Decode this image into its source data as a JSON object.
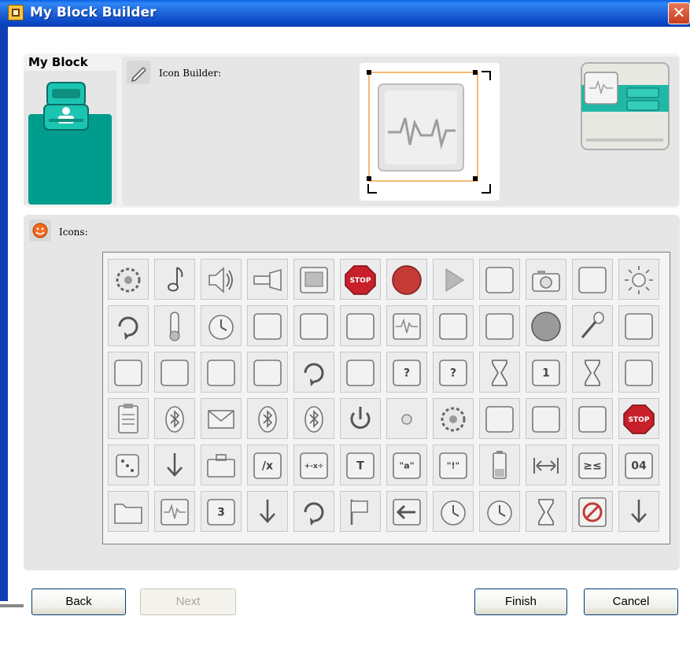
{
  "window": {
    "title": "My Block Builder",
    "close_icon": "close-x-icon"
  },
  "my_block": {
    "label": "My Block",
    "accent_color": "#009C8E"
  },
  "icon_builder": {
    "label": "Icon Builder:",
    "tool_icon": "pencil-icon"
  },
  "icons_panel": {
    "label": "Icons:",
    "panel_icon": "smiley-icon"
  },
  "buttons": {
    "back": "Back",
    "next": "Next",
    "finish": "Finish",
    "cancel": "Cancel"
  },
  "icon_grid": {
    "rows": [
      [
        {
          "name": "gear-icon"
        },
        {
          "name": "music-note-icon"
        },
        {
          "name": "speaker-icon"
        },
        {
          "name": "flashlight-icon"
        },
        {
          "name": "display-icon"
        },
        {
          "name": "stop-sign-icon",
          "text": "STOP"
        },
        {
          "name": "record-icon"
        },
        {
          "name": "play-icon"
        },
        {
          "name": "motor-icon"
        },
        {
          "name": "camera-icon"
        },
        {
          "name": "pointer-sensor-icon"
        },
        {
          "name": "light-icon"
        }
      ],
      [
        {
          "name": "rotation-sensor-icon"
        },
        {
          "name": "thermometer-icon"
        },
        {
          "name": "timer-icon"
        },
        {
          "name": "sound-sensor-icon"
        },
        {
          "name": "touch-sensor-icon"
        },
        {
          "name": "wireless-send-icon"
        },
        {
          "name": "waveform-icon"
        },
        {
          "name": "wireless-receive-icon"
        },
        {
          "name": "broadcast-icon"
        },
        {
          "name": "dial-icon"
        },
        {
          "name": "microphone-icon"
        },
        {
          "name": "ultrasonic-icon"
        }
      ],
      [
        {
          "name": "nxt-brick-icon"
        },
        {
          "name": "motor-block-icon"
        },
        {
          "name": "data-block-icon"
        },
        {
          "name": "box-icon"
        },
        {
          "name": "loop-icon"
        },
        {
          "name": "switch-icon"
        },
        {
          "name": "compare-icon",
          "text": "?"
        },
        {
          "name": "logic-icon",
          "text": "?"
        },
        {
          "name": "hourglass-icon"
        },
        {
          "name": "variable-icon",
          "text": "1"
        },
        {
          "name": "wait-icon"
        },
        {
          "name": "block-flow-icon"
        }
      ],
      [
        {
          "name": "clipboard-icon"
        },
        {
          "name": "bluetooth-icon"
        },
        {
          "name": "envelope-icon"
        },
        {
          "name": "bluetooth-send-icon"
        },
        {
          "name": "bluetooth-receive-icon"
        },
        {
          "name": "power-icon"
        },
        {
          "name": "dot-icon"
        },
        {
          "name": "gears-icon"
        },
        {
          "name": "play-gear-icon"
        },
        {
          "name": "fast-forward-gear-icon"
        },
        {
          "name": "skip-gear-icon"
        },
        {
          "name": "stop-gear-icon",
          "text": "STOP"
        }
      ],
      [
        {
          "name": "dice-icon"
        },
        {
          "name": "down-arrow-icon"
        },
        {
          "name": "briefcase-icon"
        },
        {
          "name": "percent-icon",
          "text": "/x"
        },
        {
          "name": "math-icon",
          "text": "+-x÷"
        },
        {
          "name": "text-icon",
          "text": "T"
        },
        {
          "name": "string-icon",
          "text": "\"a\""
        },
        {
          "name": "exclaim-icon",
          "text": "\"!\""
        },
        {
          "name": "battery-icon"
        },
        {
          "name": "range-icon"
        },
        {
          "name": "compare-op-icon",
          "text": "≥≤"
        },
        {
          "name": "counter-icon",
          "text": "04"
        }
      ],
      [
        {
          "name": "folder-icon"
        },
        {
          "name": "waveform-small-icon"
        },
        {
          "name": "counter-3-icon",
          "text": "3"
        },
        {
          "name": "arrow-down-thin-icon"
        },
        {
          "name": "refresh-icon"
        },
        {
          "name": "flag-icon"
        },
        {
          "name": "left-arrow-icon"
        },
        {
          "name": "clock-icon"
        },
        {
          "name": "clock-stop-icon"
        },
        {
          "name": "hourglass-tile-icon"
        },
        {
          "name": "no-entry-icon"
        },
        {
          "name": "download-icon"
        }
      ]
    ]
  }
}
